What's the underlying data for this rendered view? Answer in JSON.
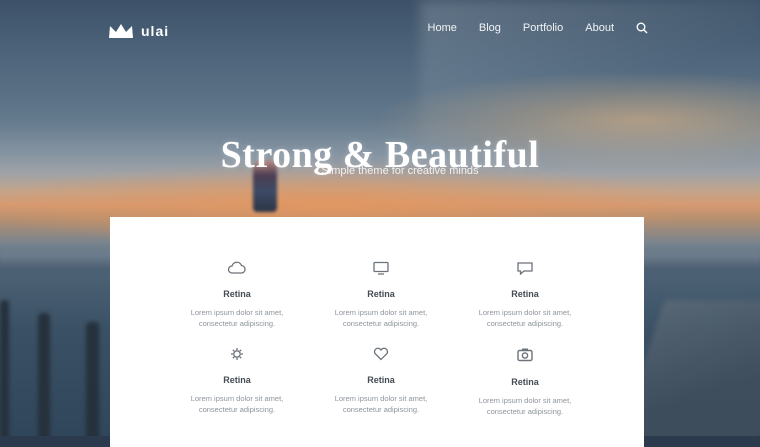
{
  "brand": {
    "logo_icon": "crown-logo-icon",
    "name": "ulai"
  },
  "nav": {
    "items": [
      {
        "label": "Home"
      },
      {
        "label": "Blog"
      },
      {
        "label": "Portfolio"
      },
      {
        "label": "About"
      }
    ],
    "search_icon": "search-icon"
  },
  "hero": {
    "headline": "Strong & Beautiful",
    "tagline": "Simple theme for creative minds"
  },
  "features": [
    {
      "icon": "cloud-icon",
      "title": "Retina",
      "description": "Lorem ipsum dolor sit amet, consectetur adipiscing."
    },
    {
      "icon": "desktop-icon",
      "title": "Retina",
      "description": "Lorem ipsum dolor sit amet, consectetur adipiscing."
    },
    {
      "icon": "chat-icon",
      "title": "Retina",
      "description": "Lorem ipsum dolor sit amet, consectetur adipiscing."
    },
    {
      "icon": "gear-icon",
      "title": "Retina",
      "description": "Lorem ipsum dolor sit amet, consectetur adipiscing."
    },
    {
      "icon": "heart-icon",
      "title": "Retina",
      "description": "Lorem ipsum dolor sit amet, consectetur adipiscing."
    },
    {
      "icon": "camera-icon",
      "title": "Retina",
      "description": "Lorem ipsum dolor sit amet, consectetur adipiscing."
    }
  ],
  "colors": {
    "panel_background": "#ffffff",
    "headline_text": "#ffffff",
    "feature_title": "#444b52",
    "feature_text": "#8d949b"
  }
}
